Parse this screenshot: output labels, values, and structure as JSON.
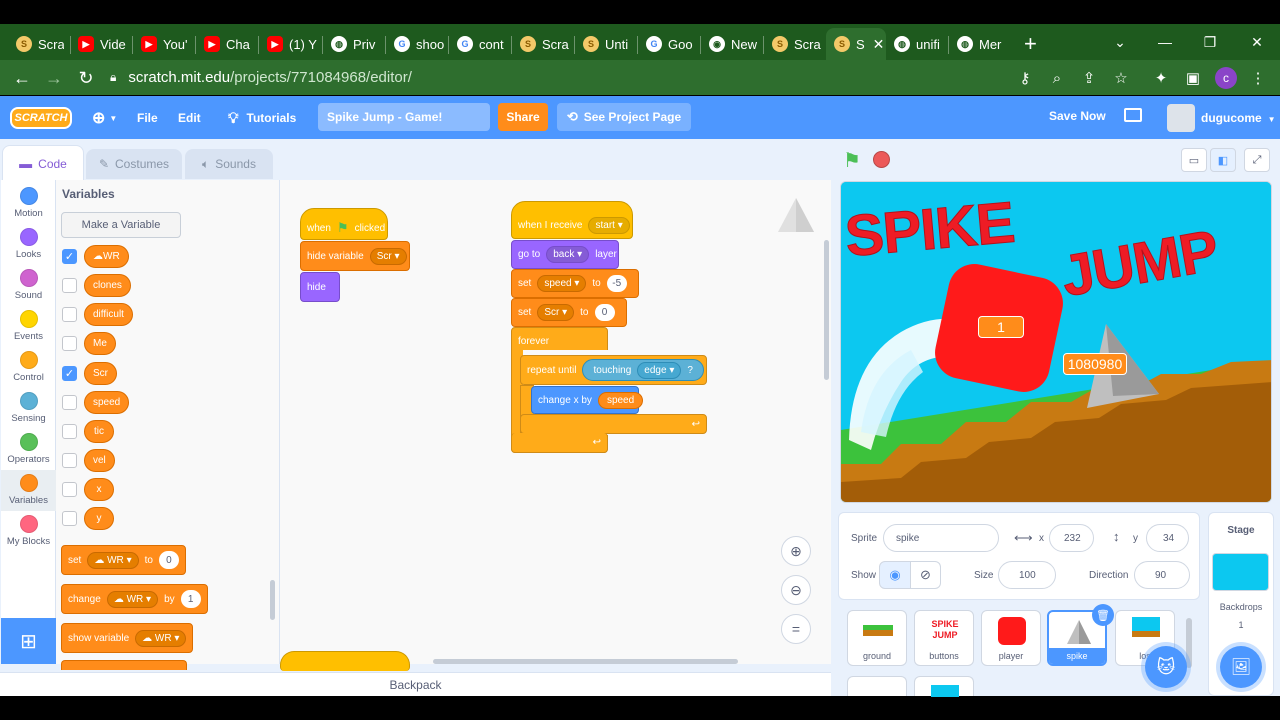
{
  "browser": {
    "tabs": [
      {
        "label": "Scra",
        "icon": "scratch-favicon",
        "color": "#f3c969"
      },
      {
        "label": "Vide",
        "icon": "youtube-favicon",
        "color": "#ff0000"
      },
      {
        "label": "You'",
        "icon": "youtube-favicon",
        "color": "#ff0000"
      },
      {
        "label": "Cha",
        "icon": "youtube-favicon",
        "color": "#ff0000"
      },
      {
        "label": "(1) Y",
        "icon": "youtube-favicon",
        "color": "#ff0000"
      },
      {
        "label": "Priv",
        "icon": "globe-favicon",
        "color": "#ffffff"
      },
      {
        "label": "shoo",
        "icon": "google-favicon",
        "color": "#ffffff"
      },
      {
        "label": "cont",
        "icon": "google-favicon",
        "color": "#ffffff"
      },
      {
        "label": "Scra",
        "icon": "scratch-favicon",
        "color": "#f3c969"
      },
      {
        "label": "Unti",
        "icon": "scratch-favicon",
        "color": "#f3c969"
      },
      {
        "label": "Goo",
        "icon": "google-favicon",
        "color": "#ffffff"
      },
      {
        "label": "New",
        "icon": "chrome-favicon",
        "color": "#ffffff"
      },
      {
        "label": "Scra",
        "icon": "scratch-favicon",
        "color": "#f3c969"
      },
      {
        "label": "S",
        "icon": "scratch-favicon",
        "color": "#f3c969",
        "active": true
      },
      {
        "label": "unifi",
        "icon": "globe-favicon",
        "color": "#ffffff"
      },
      {
        "label": "Mer",
        "icon": "globe-favicon",
        "color": "#ffffff"
      }
    ],
    "new_tab": "+",
    "url_host": "scratch.mit.edu",
    "url_path": "/projects/771084968/editor/",
    "profile_initial": "c"
  },
  "menubar": {
    "logo": "SCRATCH",
    "file": "File",
    "edit": "Edit",
    "tutorials": "Tutorials",
    "project_title": "Spike Jump - Game!",
    "share": "Share",
    "see_project_page": "See Project Page",
    "save_now": "Save Now",
    "username": "dugucome"
  },
  "editor_tabs": {
    "code": "Code",
    "costumes": "Costumes",
    "sounds": "Sounds"
  },
  "categories": [
    {
      "label": "Motion",
      "color": "#4c97ff"
    },
    {
      "label": "Looks",
      "color": "#9966ff"
    },
    {
      "label": "Sound",
      "color": "#cf63cf"
    },
    {
      "label": "Events",
      "color": "#ffd500"
    },
    {
      "label": "Control",
      "color": "#ffab19"
    },
    {
      "label": "Sensing",
      "color": "#5cb1d6"
    },
    {
      "label": "Operators",
      "color": "#59c059"
    },
    {
      "label": "Variables",
      "color": "#ff8c1a",
      "active": true
    },
    {
      "label": "My Blocks",
      "color": "#ff6680"
    }
  ],
  "palette": {
    "title": "Variables",
    "make_variable": "Make a Variable",
    "variables": [
      {
        "name": "WR",
        "checked": true,
        "cloud": true
      },
      {
        "name": "clones",
        "checked": false
      },
      {
        "name": "difficult",
        "checked": false
      },
      {
        "name": "Me",
        "checked": false
      },
      {
        "name": "Scr",
        "checked": true
      },
      {
        "name": "speed",
        "checked": false
      },
      {
        "name": "tic",
        "checked": false
      },
      {
        "name": "vel",
        "checked": false
      },
      {
        "name": "x",
        "checked": false
      },
      {
        "name": "y",
        "checked": false
      }
    ],
    "blocks": {
      "set": {
        "label": "set",
        "var": "☁ WR",
        "to": "to",
        "value": "0"
      },
      "change": {
        "label": "change",
        "var": "☁ WR",
        "by": "by",
        "value": "1"
      },
      "show": {
        "label": "show variable",
        "var": "☁ WR"
      }
    }
  },
  "scripts": {
    "s1": {
      "when_clicked": {
        "when": "when",
        "clicked": "clicked"
      },
      "hide_variable": {
        "label": "hide variable",
        "var": "Scr"
      },
      "hide": "hide"
    },
    "s2": {
      "when_receive": {
        "label": "when I receive",
        "msg": "start"
      },
      "go_to": {
        "label": "go to",
        "layer": "back",
        "suffix": "layer"
      },
      "set_speed": {
        "label": "set",
        "var": "speed",
        "to": "to",
        "value": "-5"
      },
      "set_scr": {
        "label": "set",
        "var": "Scr",
        "to": "to",
        "value": "0"
      },
      "forever": "forever",
      "repeat_until": "repeat until",
      "touching": {
        "label": "touching",
        "target": "edge",
        "q": "?"
      },
      "change_x": {
        "label": "change x by",
        "var": "speed"
      }
    }
  },
  "backpack": "Backpack",
  "stage": {
    "title_1": "SPIKE",
    "title_2": "JUMP",
    "wr_monitor": "1",
    "scr_monitor": "1080980"
  },
  "sprite_info": {
    "sprite_label": "Sprite",
    "sprite_name": "spike",
    "x_label": "x",
    "x_value": "232",
    "y_label": "y",
    "y_value": "34",
    "show_label": "Show",
    "size_label": "Size",
    "size_value": "100",
    "direction_label": "Direction",
    "direction_value": "90"
  },
  "sprites": [
    {
      "name": "ground"
    },
    {
      "name": "buttons",
      "thumb_text": "SPIKE JUMP"
    },
    {
      "name": "player"
    },
    {
      "name": "spike",
      "selected": true
    },
    {
      "name": "los"
    }
  ],
  "stage_panel": {
    "title": "Stage",
    "backdrops_label": "Backdrops",
    "backdrops_count": "1"
  }
}
